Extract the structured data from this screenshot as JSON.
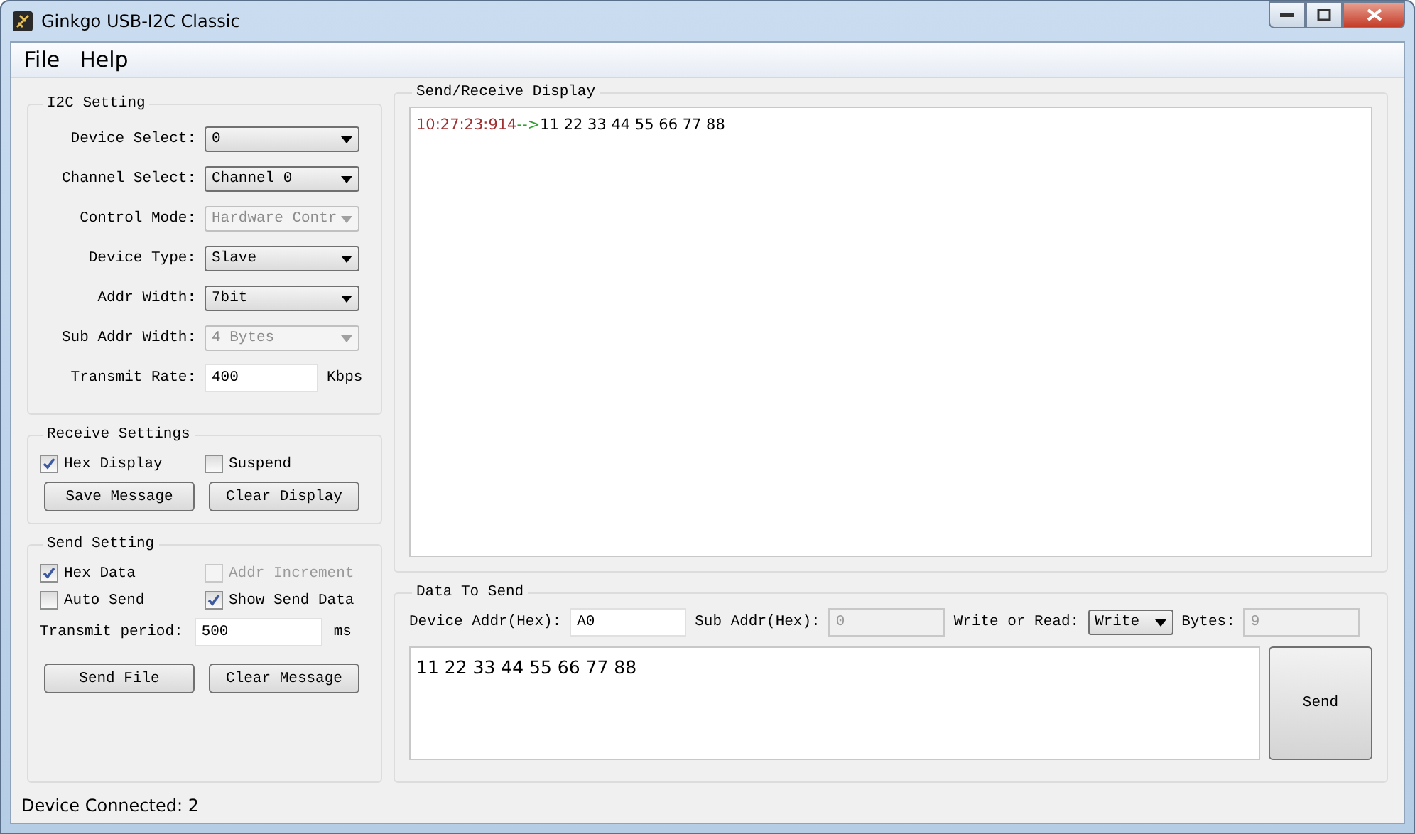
{
  "window": {
    "title": "Ginkgo USB-I2C Classic"
  },
  "menu": [
    {
      "label": "File"
    },
    {
      "label": "Help"
    }
  ],
  "i2c_setting": {
    "title": "I2C Setting",
    "fields": [
      {
        "label": "Device Select:",
        "kind": "select",
        "value": "0",
        "disabled": false
      },
      {
        "label": "Channel Select:",
        "kind": "select",
        "value": "Channel 0",
        "disabled": false
      },
      {
        "label": "Control Mode:",
        "kind": "select",
        "value": "Hardware Contr",
        "disabled": true
      },
      {
        "label": "Device Type:",
        "kind": "select",
        "value": "Slave",
        "disabled": false
      },
      {
        "label": "Addr Width:",
        "kind": "select",
        "value": "7bit",
        "disabled": false
      },
      {
        "label": "Sub Addr Width:",
        "kind": "select",
        "value": "4 Bytes",
        "disabled": true
      },
      {
        "label": "Transmit Rate:",
        "kind": "input",
        "value": "400",
        "unit": "Kbps",
        "disabled": false
      }
    ]
  },
  "receive_settings": {
    "title": "Receive Settings",
    "checkboxes": [
      {
        "label": "Hex Display",
        "checked": true,
        "disabled": false
      },
      {
        "label": "Suspend",
        "checked": false,
        "disabled": false
      }
    ],
    "buttons": [
      "Save Message",
      "Clear Display"
    ]
  },
  "send_setting": {
    "title": "Send Setting",
    "checkboxes": [
      {
        "label": "Hex Data",
        "checked": true,
        "disabled": false
      },
      {
        "label": "Addr Increment",
        "checked": false,
        "disabled": true
      },
      {
        "label": "Auto Send",
        "checked": false,
        "disabled": false
      },
      {
        "label": "Show Send Data",
        "checked": true,
        "disabled": false
      }
    ],
    "transmit_period": {
      "label": "Transmit period:",
      "value": "500",
      "unit": "ms"
    },
    "buttons": [
      "Send File",
      "Clear Message"
    ]
  },
  "display": {
    "title": "Send/Receive Display",
    "lines": [
      {
        "timestamp": "10:27:23:914",
        "arrow": "-->",
        "data": "11 22 33 44 55 66 77 88"
      }
    ]
  },
  "data_to_send": {
    "title": "Data To Send",
    "fields": [
      {
        "label": "Device Addr(Hex):",
        "kind": "input",
        "value": "A0",
        "disabled": false
      },
      {
        "label": "Sub Addr(Hex):",
        "kind": "input",
        "value": "0",
        "disabled": true
      },
      {
        "label": "Write or Read:",
        "kind": "select",
        "value": "Write",
        "disabled": false
      },
      {
        "label": "Bytes:",
        "kind": "input",
        "value": "9",
        "disabled": true
      }
    ],
    "text": "11 22 33 44 55 66 77 88",
    "send_button": "Send"
  },
  "status_bar": {
    "text": "Device Connected: 2"
  }
}
